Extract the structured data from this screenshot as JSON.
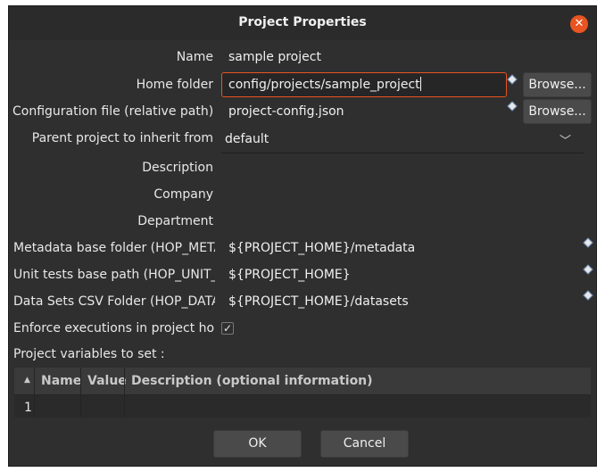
{
  "dialog": {
    "title": "Project Properties",
    "close_icon": "close-icon"
  },
  "fields": {
    "name": {
      "label": "Name",
      "value": "sample project"
    },
    "home_folder": {
      "label": "Home folder",
      "value": "config/projects/sample_project",
      "browse_label": "Browse..."
    },
    "config_file": {
      "label": "Configuration file (relative path)",
      "value": "project-config.json",
      "browse_label": "Browse..."
    },
    "parent_project": {
      "label": "Parent project to inherit from",
      "value": "default"
    },
    "description": {
      "label": "Description",
      "value": ""
    },
    "company": {
      "label": "Company",
      "value": ""
    },
    "department": {
      "label": "Department",
      "value": ""
    },
    "metadata_folder": {
      "label": "Metadata base folder (HOP_META",
      "value": "${PROJECT_HOME}/metadata"
    },
    "unit_tests_path": {
      "label": "Unit tests base path (HOP_UNIT_T",
      "value": "${PROJECT_HOME}"
    },
    "datasets_folder": {
      "label": "Data Sets CSV Folder (HOP_DATAS",
      "value": "${PROJECT_HOME}/datasets"
    },
    "enforce_executions": {
      "label": "Enforce executions in project hom",
      "checked": true
    }
  },
  "variables_table": {
    "label": "Project variables to set :",
    "columns": [
      "Name",
      "Value",
      "Description (optional information)"
    ],
    "rows": [
      "1"
    ]
  },
  "buttons": {
    "ok": "OK",
    "cancel": "Cancel"
  },
  "colors": {
    "accent": "#e95420",
    "background": "#2f2f2f"
  }
}
